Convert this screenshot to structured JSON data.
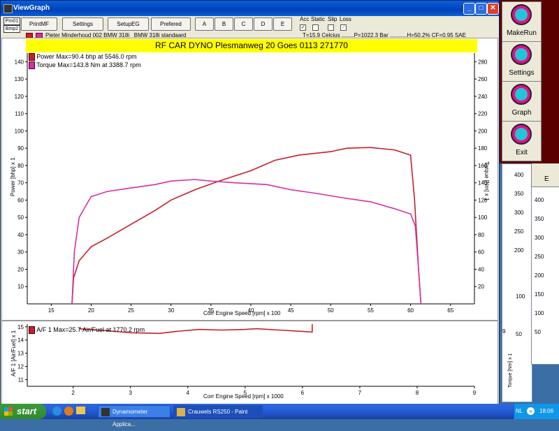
{
  "window": {
    "title": "ViewGraph",
    "minimize": "_",
    "maximize": "□",
    "close": "✕"
  },
  "side_buttons": [
    "Prn01",
    "Bmp2"
  ],
  "toolbar": {
    "buttons": [
      "PrintMF",
      "Settings",
      "SetupEG",
      "Prefered",
      "A",
      "B",
      "C",
      "D",
      "E"
    ]
  },
  "options": {
    "labels": [
      "Acc",
      "Static",
      "Slip",
      "Loss"
    ],
    "checked": [
      true,
      false,
      false,
      false
    ]
  },
  "info": {
    "vehicle": "Pieter Minderhoud 002 BMW 318i   BMW 318i standaard",
    "conditions": "T=15.9 Celcius ........P=1022.3 Bar ...........H=50.2% CF=0.95 SAE"
  },
  "banner": "RF CAR DYNO  Plesmanweg 20 Goes  0113 271770",
  "colors": {
    "power": "#c81e2a",
    "torque": "#d6309e",
    "af": "#c81e2a",
    "banner": "#ffff00"
  },
  "chart_data": [
    {
      "type": "line",
      "title": "RF CAR DYNO  Plesmanweg 20 Goes  0113 271770",
      "xlabel": "Corr Engine Speed [rpm] x 100",
      "ylabel": "Power [bhp] x 1",
      "y2label": "Torque [Nm] x 1",
      "xlim": [
        12,
        68
      ],
      "ylim": [
        0,
        145
      ],
      "y2lim": [
        0,
        290
      ],
      "x_ticks": [
        15,
        20,
        25,
        30,
        35,
        40,
        45,
        50,
        55,
        60,
        65
      ],
      "y_ticks": [
        10,
        20,
        30,
        40,
        50,
        60,
        70,
        80,
        90,
        100,
        110,
        120,
        130,
        140
      ],
      "y2_ticks": [
        20,
        40,
        60,
        80,
        100,
        120,
        140,
        160,
        180,
        200,
        220,
        240,
        260,
        280
      ],
      "legend": [
        "Power  Max=90.4 bhp at 5546.0 rpm",
        "Torque  Max=143.8 Nm at 3388.7 rpm"
      ],
      "legend_position": "top-left",
      "series": [
        {
          "name": "Power",
          "axis": "left",
          "x": [
            17.6,
            17.8,
            18.5,
            20,
            22,
            25,
            28,
            30,
            33,
            36,
            40,
            43,
            46,
            50,
            52,
            55,
            58,
            60,
            60.5,
            61,
            61.3
          ],
          "values": [
            0,
            15,
            25,
            33,
            38,
            46,
            54,
            60,
            66,
            71,
            77,
            83,
            86,
            88,
            90,
            90.4,
            89,
            86,
            60,
            20,
            0
          ]
        },
        {
          "name": "Torque",
          "axis": "right",
          "x": [
            17.6,
            17.9,
            18.5,
            20,
            22,
            25,
            28,
            30,
            33,
            35,
            38,
            42,
            45,
            48,
            52,
            55,
            58,
            60,
            60.6,
            61,
            61.3
          ],
          "values": [
            0,
            60,
            100,
            124,
            130,
            134,
            138,
            142,
            143.8,
            142,
            140,
            138,
            132,
            128,
            122,
            118,
            110,
            104,
            90,
            40,
            0
          ]
        }
      ]
    },
    {
      "type": "line",
      "xlabel": "Corr Engine Speed [rpm] x 1000",
      "ylabel": "A/F 1 [Air/Fuel] x 1",
      "xlim": [
        1.2,
        9
      ],
      "ylim": [
        10.5,
        15.2
      ],
      "x_ticks": [
        2,
        3,
        4,
        5,
        6,
        7,
        8,
        9
      ],
      "y_ticks": [
        11,
        12,
        13,
        14,
        15
      ],
      "legend": [
        "A/F 1  Max=25.7 Air/Fuel at 1770.2 rpm"
      ],
      "series": [
        {
          "name": "A/F 1",
          "x": [
            2.1,
            2.6,
            3.0,
            3.5,
            3.8,
            4.2,
            4.6,
            5.0,
            5.2,
            5.6,
            6.0,
            6.17,
            6.17
          ],
          "values": [
            14.85,
            14.7,
            14.55,
            14.5,
            14.65,
            14.8,
            14.75,
            14.8,
            14.85,
            14.75,
            14.65,
            14.6,
            15.2
          ]
        }
      ]
    }
  ],
  "right_panel": {
    "buttons": [
      "MakeRun",
      "Settings",
      "Graph",
      "Exit"
    ]
  },
  "background_windows": {
    "e_label": "E",
    "torque_axis_label": "Torque [Nm] x 1",
    "ticks_a": [
      "400",
      "350",
      "300",
      "250",
      "200"
    ],
    "ticks_b": [
      "400",
      "350",
      "300",
      "250",
      "200",
      "150",
      "100",
      "50"
    ],
    "ticks_c": [
      "100",
      "50"
    ],
    "bottom_tick": "9"
  },
  "taskbar": {
    "start": "start",
    "tasks": [
      "Dynamometer Applica...",
      "Crauwels RS250 - Paint"
    ],
    "lang": "NL",
    "time": "18:06"
  }
}
